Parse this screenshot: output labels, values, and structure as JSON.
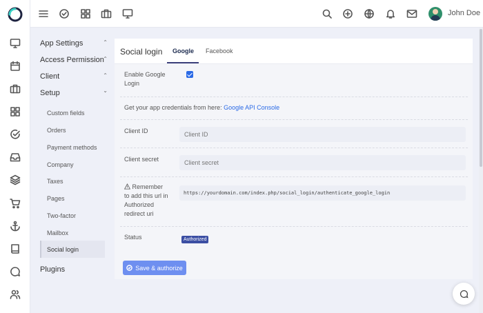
{
  "user": {
    "name": "John Doe"
  },
  "nav": {
    "app_settings": "App Settings",
    "access_permission": "Access Permission",
    "client": "Client",
    "setup": "Setup",
    "setup_items": [
      "Custom fields",
      "Orders",
      "Payment methods",
      "Company",
      "Taxes",
      "Pages",
      "Two-factor",
      "Mailbox",
      "Social login"
    ],
    "plugins": "Plugins",
    "active_item": "Social login"
  },
  "panel": {
    "title": "Social login",
    "tabs": [
      "Google",
      "Facebook"
    ],
    "active_tab": "Google"
  },
  "form": {
    "enable_label": "Enable Google Login",
    "enable_checked": true,
    "credentials_text": "Get your app credentials from here:",
    "credentials_link": "Google API Console",
    "client_id_label": "Client ID",
    "client_id_placeholder": "Client ID",
    "client_secret_label": "Client secret",
    "client_secret_placeholder": "Client secret",
    "remember_label": "Remember to add this url in Authorized redirect uri",
    "redirect_url": "https://yourdomain.com/index.php/social_login/authenticate_google_login",
    "status_label": "Status",
    "status_badge": "Authorized",
    "save_button": "Save & authorize"
  },
  "colors": {
    "accent": "#2b6ae6",
    "badge": "#3b4ea3",
    "button": "#6e8ff0"
  }
}
